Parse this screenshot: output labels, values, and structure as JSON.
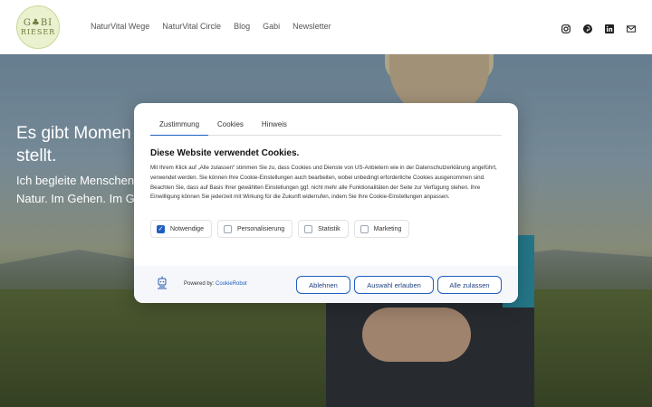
{
  "header": {
    "logo": {
      "line1": "G♣BI",
      "line2": "RIESER"
    },
    "nav": [
      "NaturVital Wege",
      "NaturVital Circle",
      "Blog",
      "Gabi",
      "Newsletter"
    ],
    "social_icons": [
      "instagram-icon",
      "pinterest-icon",
      "linkedin-icon",
      "mail-icon"
    ]
  },
  "hero": {
    "title_line1": "Es gibt Momen",
    "title_line2": "stellt.",
    "sub_line1": "Ich begleite Menschen",
    "sub_line2": "Natur. Im Gehen. Im Ges"
  },
  "cookie": {
    "tabs": [
      "Zustimmung",
      "Cookies",
      "Hinweis"
    ],
    "title": "Diese Website verwendet Cookies.",
    "text": "Mit Ihrem Klick auf „Alle zulassen“ stimmen Sie zu, dass Cookies und Dienste von US-Anbietern wie in der Datenschutzerklärung angeführt, verwendet werden. Sie können Ihre Cookie-Einstellungen auch bearbeiten, wobei unbedingt erforderliche Cookies ausgenommen sind. Beachten Sie, dass auf Basis Ihrer gewählten Einstellungen ggf. nicht mehr alle Funktionalitäten der Seite zur Verfügung stehen. Ihre Einwilligung können Sie jederzeit mit Wirkung für die Zukunft widerrufen, indem Sie Ihre Cookie-Einstellungen anpassen.",
    "categories": [
      {
        "label": "Notwendige",
        "checked": true
      },
      {
        "label": "Personalisierung",
        "checked": false
      },
      {
        "label": "Statistik",
        "checked": false
      },
      {
        "label": "Marketing",
        "checked": false
      }
    ],
    "powered_prefix": "Powered by:",
    "powered_link": "CookieRobot",
    "buttons": {
      "decline": "Ablehnen",
      "select": "Auswahl erlauben",
      "all": "Alle zulassen"
    }
  },
  "colors": {
    "accent": "#1f5fbf",
    "logo_bg": "#eaf1cf"
  }
}
